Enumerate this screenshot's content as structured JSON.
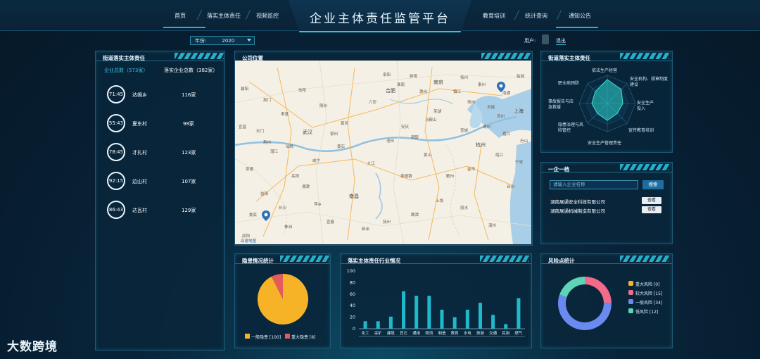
{
  "header": {
    "title": "企业主体责任监管平台",
    "nav_left": [
      "首页",
      "落实主体责任",
      "视频监控"
    ],
    "nav_right": [
      "教育培训",
      "统计查询",
      "通知公告"
    ]
  },
  "toolbar": {
    "year_label": "年份:",
    "year_value": "2020",
    "user_label": "用户:",
    "logout_label": "退出"
  },
  "left_panel": {
    "title": "街道落实主体责任",
    "total_label": "企业总数（573家）",
    "implemented_label": "落实企业总数（382家）",
    "rows": [
      {
        "score": "71:45",
        "name": "达姆乡",
        "count": "116家"
      },
      {
        "score": "55:43",
        "name": "夏东村",
        "count": "98家"
      },
      {
        "score": "78:45",
        "name": "才扎村",
        "count": "123家"
      },
      {
        "score": "92:15",
        "name": "边山村",
        "count": "107家"
      },
      {
        "score": "86:43",
        "name": "达瓦村",
        "count": "129家"
      }
    ]
  },
  "map_panel": {
    "title": "公司位置",
    "cities_big": [
      "武汉",
      "合肥",
      "南京",
      "上海",
      "杭州",
      "南昌"
    ],
    "cities_small": [
      "襄阳",
      "信阳",
      "阜阳",
      "蚌埠",
      "淮南",
      "六安",
      "安庆",
      "芜湖",
      "宣城",
      "湖州",
      "嘉兴",
      "绍兴",
      "宁波",
      "金华",
      "衢州",
      "黄山",
      "景德镇",
      "九江",
      "黄石",
      "咸宁",
      "岳阳",
      "荆州",
      "宜昌",
      "常德",
      "益阳",
      "长沙",
      "株洲",
      "萍乡",
      "宜春",
      "新余",
      "抚州",
      "鹰潭",
      "上饶",
      "丽水",
      "温州",
      "台州",
      "舟山",
      "苏州",
      "无锡",
      "常州",
      "镇江",
      "扬州",
      "泰州",
      "南通",
      "盐城",
      "滁州",
      "马鞍山",
      "铜陵",
      "池州",
      "孝感",
      "随州",
      "荆门",
      "天门",
      "潜江",
      "仙桃",
      "鄂州",
      "黄冈",
      "湘潭",
      "娄底",
      "邵阳"
    ],
    "attribution": "高德地图"
  },
  "radar_panel": {
    "title": "街道落实主体责任",
    "axes": [
      "依法生产经营",
      "安全机构、规章制度建设",
      "安全生产投入",
      "宣传教育培训",
      "安全生产管理责任",
      "隐患治理与风险管控",
      "事故报告与应急救援",
      "职业病预防"
    ],
    "values": [
      0.85,
      0.7,
      0.55,
      0.5,
      0.6,
      0.5,
      0.55,
      0.6
    ]
  },
  "company_panel": {
    "title": "一企一档",
    "search_placeholder": "请输入企业名称",
    "search_button": "搜索",
    "companies": [
      {
        "name": "湖南展通安全科技有限公司",
        "action": "查看"
      },
      {
        "name": "湖南展通机械制造有限公司",
        "action": "查看"
      }
    ]
  },
  "hazard_panel": {
    "title": "隐患情况统计",
    "legend": [
      {
        "label": "一般隐患 [100]",
        "color": "#f7b328"
      },
      {
        "label": "重大隐患 [8]",
        "color": "#e35b5b"
      }
    ]
  },
  "industry_panel": {
    "title": "落实主体责任行业情况"
  },
  "risk_panel": {
    "title": "风险点统计",
    "legend": [
      {
        "label": "重大风险 [0]",
        "color": "#f7b328"
      },
      {
        "label": "较大风险 [15]",
        "color": "#f26b8a"
      },
      {
        "label": "一般风险 [34]",
        "color": "#6a8af0"
      },
      {
        "label": "低风险 [12]",
        "color": "#5fd3b8"
      }
    ]
  },
  "chart_data": [
    {
      "type": "pie",
      "title": "隐患情况统计",
      "slices": [
        {
          "name": "一般隐患",
          "value": 100,
          "color": "#f7b328"
        },
        {
          "name": "重大隐患",
          "value": 8,
          "color": "#e35b5b"
        }
      ]
    },
    {
      "type": "bar",
      "title": "落实主体责任行业情况",
      "categories": [
        "化工",
        "采矿",
        "建筑",
        "其它",
        "通用",
        "物流",
        "制造",
        "教育",
        "水电",
        "旅游",
        "交通",
        "民用",
        "燃气"
      ],
      "values": [
        13,
        13,
        21,
        65,
        57,
        57,
        33,
        20,
        33,
        45,
        24,
        8,
        53
      ],
      "ylim": [
        0,
        100
      ],
      "yticks": [
        0,
        20,
        40,
        60,
        80,
        100
      ],
      "color": "#20b9c9"
    },
    {
      "type": "pie",
      "title": "风险点统计",
      "donut": true,
      "slices": [
        {
          "name": "重大风险",
          "value": 0,
          "color": "#f7b328"
        },
        {
          "name": "较大风险",
          "value": 15,
          "color": "#f26b8a"
        },
        {
          "name": "一般风险",
          "value": 34,
          "color": "#6a8af0"
        },
        {
          "name": "低风险",
          "value": 12,
          "color": "#5fd3b8"
        }
      ]
    }
  ],
  "watermark": "大数跨境"
}
